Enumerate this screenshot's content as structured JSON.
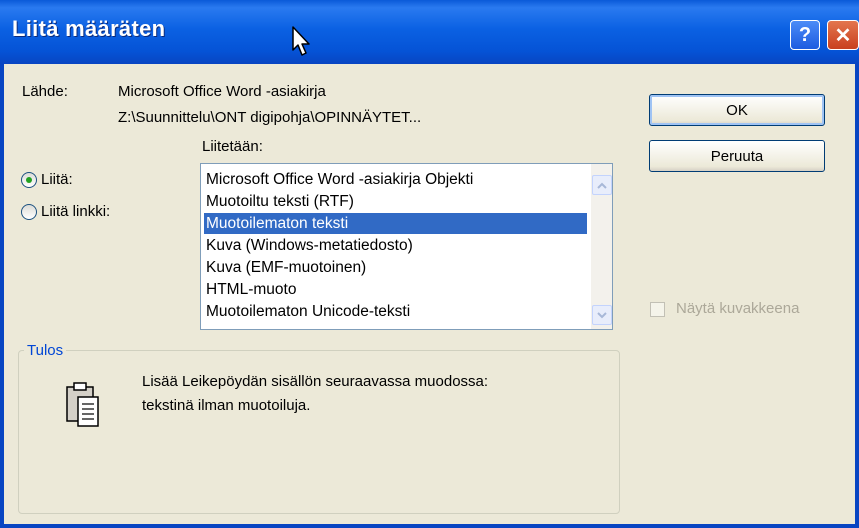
{
  "window": {
    "title": "Liitä määräten",
    "help_glyph": "?",
    "close_glyph": "✕"
  },
  "source": {
    "label": "Lähde:",
    "line1": "Microsoft Office Word -asiakirja",
    "line2": "Z:\\Suunnittelu\\ONT digipohja\\OPINNÄYTET..."
  },
  "paste_as": {
    "label": "Liitetään:",
    "items": [
      "Microsoft Office Word -asiakirja Objekti",
      "Muotoiltu teksti (RTF)",
      "Muotoilematon teksti",
      "Kuva (Windows-metatiedosto)",
      "Kuva (EMF-muotoinen)",
      "HTML-muoto",
      "Muotoilematon Unicode-teksti"
    ],
    "selected": "Muotoilematon teksti"
  },
  "radios": {
    "paste_label": "Liitä:",
    "paste_link_label": "Liitä linkki:",
    "selected": "paste"
  },
  "buttons": {
    "ok": "OK",
    "cancel": "Peruuta"
  },
  "checkbox": {
    "label": "Näytä kuvakkeena",
    "checked": false,
    "enabled": false
  },
  "result": {
    "title": "Tulos",
    "line1": "Lisää Leikepöydän sisällön seuraavassa muodossa:",
    "line2": "tekstinä ilman muotoiluja."
  },
  "colors": {
    "titlebar": "#0b61e3",
    "selection": "#316ac5",
    "radio_dot": "#21a121",
    "group_title": "#0046d5"
  },
  "icons": {
    "help": "help-icon",
    "close": "close-icon",
    "cursor": "mouse-cursor-icon",
    "clipboard": "clipboard-icon",
    "scroll_up": "chevron-up-icon",
    "scroll_down": "chevron-down-icon"
  }
}
